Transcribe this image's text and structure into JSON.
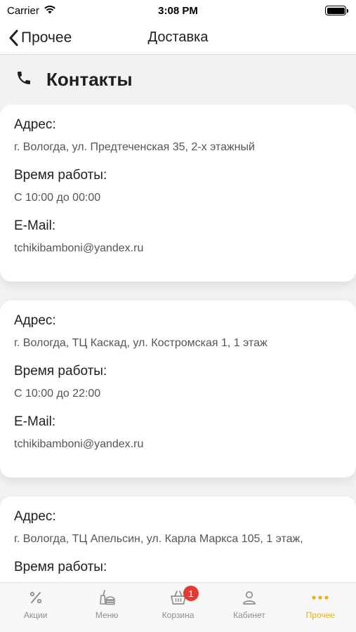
{
  "status_bar": {
    "carrier": "Carrier",
    "time": "3:08 PM"
  },
  "nav": {
    "back_label": "Прочее",
    "title": "Доставка"
  },
  "section": {
    "title": "Контакты",
    "icon": "phone-icon"
  },
  "contacts": [
    {
      "address_label": "Адрес:",
      "address": "г. Вологда, ул. Предтеченская 35, 2-х этажный",
      "hours_label": "Время работы:",
      "hours": "С 10:00 до 00:00",
      "email_label": "E-Mail:",
      "email": "tchikibamboni@yandex.ru"
    },
    {
      "address_label": "Адрес:",
      "address": "г. Вологда, ТЦ Каскад, ул. Костромская 1, 1 этаж",
      "hours_label": "Время работы:",
      "hours": "С 10:00 до 22:00",
      "email_label": "E-Mail:",
      "email": "tchikibamboni@yandex.ru"
    },
    {
      "address_label": "Адрес:",
      "address": "г. Вологда, ТЦ Апельсин, ул.  Карла Маркса 105, 1 этаж,",
      "hours_label": "Время работы:"
    }
  ],
  "tabs": [
    {
      "label": "Акции",
      "icon": "percent-icon",
      "active": false
    },
    {
      "label": "Меню",
      "icon": "menu-icon",
      "active": false
    },
    {
      "label": "Корзина",
      "icon": "basket-icon",
      "active": false,
      "badge": "1"
    },
    {
      "label": "Кабинет",
      "icon": "user-icon",
      "active": false
    },
    {
      "label": "Прочее",
      "icon": "more-icon",
      "active": true
    }
  ],
  "colors": {
    "accent": "#e9b30b",
    "badge": "#e53935",
    "inactive": "#8e8e8e"
  }
}
